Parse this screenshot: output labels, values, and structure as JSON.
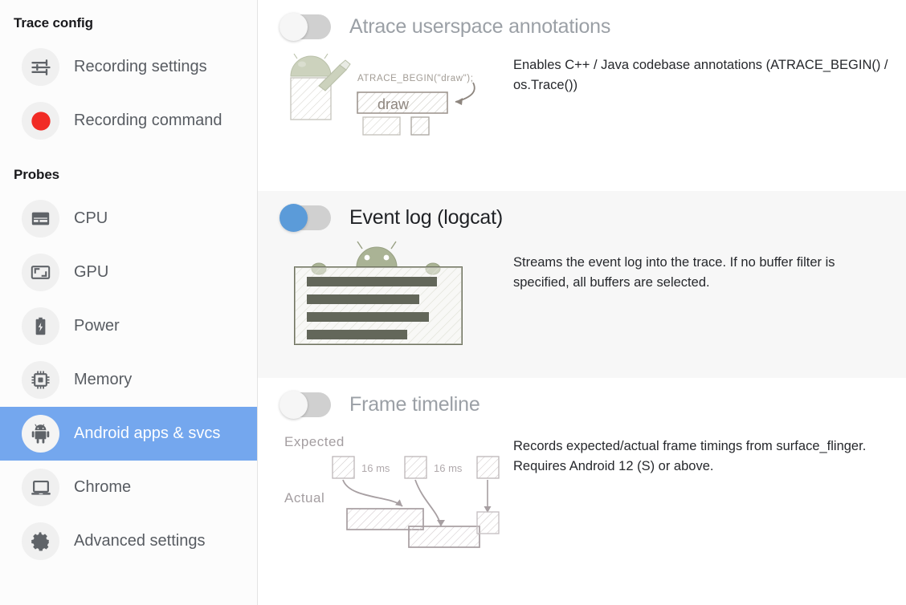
{
  "sidebar": {
    "sections": [
      {
        "title": "Trace config",
        "items": [
          {
            "label": "Recording settings",
            "icon": "sliders-icon",
            "active": false
          },
          {
            "label": "Recording command",
            "icon": "record-dot-icon",
            "active": false
          }
        ]
      },
      {
        "title": "Probes",
        "items": [
          {
            "label": "CPU",
            "icon": "cpu-icon",
            "active": false
          },
          {
            "label": "GPU",
            "icon": "gpu-icon",
            "active": false
          },
          {
            "label": "Power",
            "icon": "battery-icon",
            "active": false
          },
          {
            "label": "Memory",
            "icon": "memory-chip-icon",
            "active": false
          },
          {
            "label": "Android apps & svcs",
            "icon": "android-icon",
            "active": true
          },
          {
            "label": "Chrome",
            "icon": "laptop-icon",
            "active": false
          },
          {
            "label": "Advanced settings",
            "icon": "gear-icon",
            "active": false
          }
        ]
      }
    ]
  },
  "probes": [
    {
      "title": "Atrace userspace annotations",
      "enabled": false,
      "toggle_state": "off",
      "description": "Enables C++ / Java codebase annotations (ATRACE_BEGIN() / os.Trace())",
      "illustration": {
        "name": "atrace-annotation-illustration",
        "code_label": "ATRACE_BEGIN(\"draw\");",
        "slice_label": "draw"
      }
    },
    {
      "title": "Event log (logcat)",
      "enabled": true,
      "toggle_state": "on",
      "description": "Streams the event log into the trace. If no buffer filter is specified, all buffers are selected.",
      "illustration": {
        "name": "logcat-illustration"
      }
    },
    {
      "title": "Frame timeline",
      "enabled": false,
      "toggle_state": "off",
      "description": "Records expected/actual frame timings from surface_flinger. Requires Android 12 (S) or above.",
      "illustration": {
        "name": "frame-timeline-illustration",
        "expected_label": "Expected",
        "actual_label": "Actual",
        "interval_label_1": "16 ms",
        "interval_label_2": "16 ms"
      }
    }
  ],
  "colors": {
    "accent": "#74a7ee",
    "toggle_on": "#5b9bd9",
    "toggle_off_track": "#d0d0d0",
    "record_red": "#f12b25",
    "sidebar_bg": "#fcfcfc",
    "enabled_section_bg": "#f7f7f7",
    "title_off": "#9ba0a6",
    "title_on": "#1f2125"
  }
}
